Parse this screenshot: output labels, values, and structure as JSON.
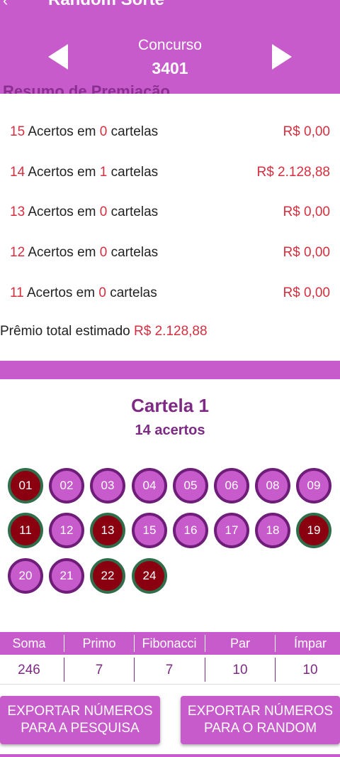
{
  "header": {
    "app_title": "Random Sorte",
    "concurso_label": "Concurso",
    "concurso_number": "3401",
    "background": "#c75bcb"
  },
  "resumo": {
    "title": "Resumo de Premiação",
    "rows": [
      {
        "acertos": "15",
        "text1": "Acertos em",
        "cartelas": "0",
        "text2": "cartelas",
        "value": "R$ 0,00"
      },
      {
        "acertos": "14",
        "text1": "Acertos em",
        "cartelas": "1",
        "text2": "cartelas",
        "value": "R$ 2.128,88"
      },
      {
        "acertos": "13",
        "text1": "Acertos em",
        "cartelas": "0",
        "text2": "cartelas",
        "value": "R$ 0,00"
      },
      {
        "acertos": "12",
        "text1": "Acertos em",
        "cartelas": "0",
        "text2": "cartelas",
        "value": "R$ 0,00"
      },
      {
        "acertos": "11",
        "text1": "Acertos em",
        "cartelas": "0",
        "text2": "cartelas",
        "value": "R$ 0,00"
      }
    ],
    "total_label": "Prêmio total estimado",
    "total_value": "R$ 2.128,88"
  },
  "cartela": {
    "title": "Cartela 1",
    "subtitle": "14 acertos",
    "numbers": [
      {
        "n": "01",
        "hit": true
      },
      {
        "n": "02",
        "hit": false
      },
      {
        "n": "03",
        "hit": false
      },
      {
        "n": "04",
        "hit": false
      },
      {
        "n": "05",
        "hit": false
      },
      {
        "n": "06",
        "hit": false
      },
      {
        "n": "08",
        "hit": false
      },
      {
        "n": "09",
        "hit": false
      },
      {
        "n": "11",
        "hit": true
      },
      {
        "n": "12",
        "hit": false
      },
      {
        "n": "13",
        "hit": true
      },
      {
        "n": "15",
        "hit": false
      },
      {
        "n": "16",
        "hit": false
      },
      {
        "n": "17",
        "hit": false
      },
      {
        "n": "18",
        "hit": false
      },
      {
        "n": "19",
        "hit": true
      },
      {
        "n": "20",
        "hit": false
      },
      {
        "n": "21",
        "hit": false
      },
      {
        "n": "22",
        "hit": true
      },
      {
        "n": "24",
        "hit": true
      }
    ]
  },
  "stats": {
    "headers": [
      "Soma",
      "Primo",
      "Fibonacci",
      "Par",
      "Ímpar"
    ],
    "values": [
      "246",
      "7",
      "7",
      "10",
      "10"
    ]
  },
  "buttons": {
    "export_pesquisa": "EXPORTAR NÚMEROS PARA A PESQUISA",
    "export_random": "EXPORTAR NÚMEROS PARA O RANDOM"
  },
  "colors": {
    "accent": "#c75bcb",
    "dark_purple": "#7e2a85",
    "hit_ball": "#8b0010",
    "money_red": "#d52f3f"
  }
}
